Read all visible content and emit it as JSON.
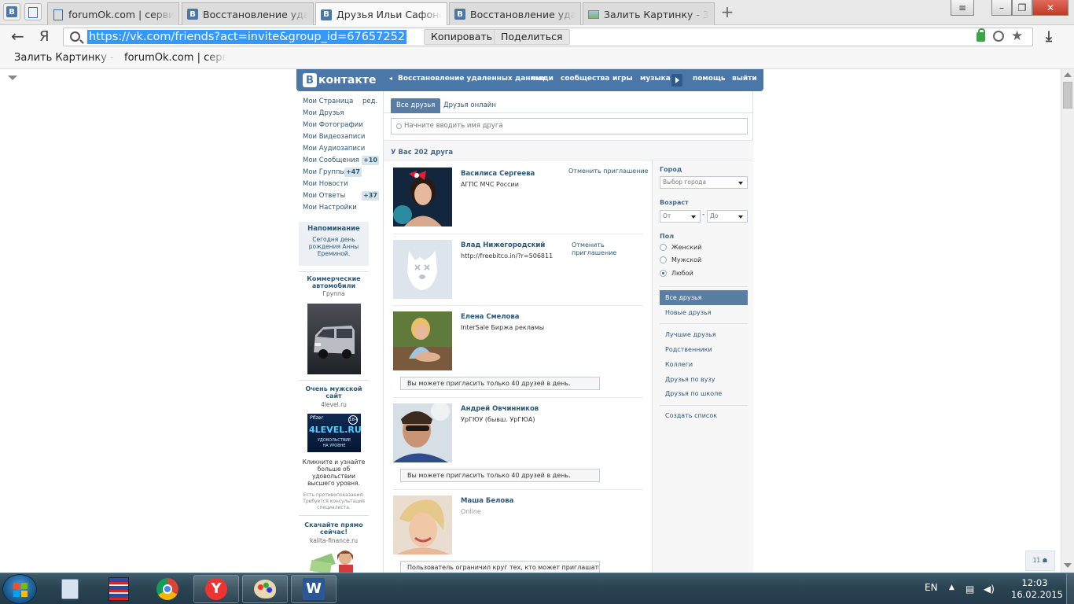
{
  "browser": {
    "tabs": [
      {
        "title": "forumOk.com | серви"
      },
      {
        "title": "Восстановление удал"
      },
      {
        "title": "Друзья Ильи Сафоно"
      },
      {
        "title": "Восстановление удал"
      },
      {
        "title": "Залить Картинку - За"
      }
    ],
    "new_tab_glyph": "+",
    "address": {
      "url": "https://vk.com/friends?act=invite&group_id=67657252",
      "copy_label": "Копировать",
      "share_label": "Поделиться"
    },
    "bookmarks": [
      "Залить Картинку - З",
      "forumOk.com | серв"
    ],
    "yandex_glyph": "Я"
  },
  "vk": {
    "logo_letter": "В",
    "logo_text": "контакте",
    "nav": {
      "back_link": "Восстановление удаленных данных",
      "links": [
        "люди",
        "сообщества",
        "игры",
        "музыка"
      ],
      "help": "помощь",
      "logout": "выйти"
    },
    "left_menu": {
      "edit": "ред.",
      "items": [
        {
          "label": "Мои Страница"
        },
        {
          "label": "Мои Друзья"
        },
        {
          "label": "Мои Фотографии"
        },
        {
          "label": "Мои Видеозаписи"
        },
        {
          "label": "Мои Аудиозаписи"
        },
        {
          "label": "Мои Сообщения",
          "count": "+10"
        },
        {
          "label": "Мои Группы",
          "count": "+47"
        },
        {
          "label": "Мои Новости"
        },
        {
          "label": "Мои Ответы",
          "count": "+37"
        },
        {
          "label": "Мои Настройки"
        }
      ]
    },
    "reminder": {
      "title": "Напоминание",
      "line1": "Сегодня день",
      "line2": "рождения Анны",
      "line3": "Ереминой."
    },
    "ads": [
      {
        "title1": "Коммерческие",
        "title2": "автомобили",
        "sub": "Группа"
      },
      {
        "title1": "Очень мужской",
        "title2": "сайт",
        "sub": "4level.ru",
        "banner_brand": "Pfizer",
        "banner_text": "4LEVEL.RU",
        "banner_tag1": "УДОВОЛЬСТВИЕ",
        "banner_tag2": "НА УРОВНЕ",
        "banner_age": "18+",
        "desc1": "Кликните и узнайте",
        "desc2": "больше об",
        "desc3": "удовольствии",
        "desc4": "высшего уровня.",
        "warn1": "Есть противопоказания.",
        "warn2": "Требуется консультация",
        "warn3": "специалиста."
      },
      {
        "title1": "Скачайте прямо",
        "title2": "сейчас!",
        "sub": "kalita-finance.ru"
      }
    ],
    "tabs": {
      "all": "Все друзья",
      "online": "Друзья онлайн"
    },
    "search_placeholder": "Начните вводить имя друга",
    "friends_count_text": "У Вас 202 друга",
    "friends": [
      {
        "name": "Василиса Сергеева",
        "sub": "АГПС МЧС России",
        "action": "Отменить приглашение"
      },
      {
        "name": "Влад Нижегородский",
        "sub": "http://freebitco.in/?r=506811",
        "action1": "Отменить",
        "action2": "приглашение"
      },
      {
        "name": "Елена Смелова",
        "sub": "InterSale Биржа рекламы",
        "notice": "Вы можете пригласить только 40 друзей в день."
      },
      {
        "name": "Андрей Овчинников",
        "sub": "УрГЮУ (бывш. УрГЮА)",
        "notice": "Вы можете пригласить только 40 друзей в день."
      },
      {
        "name": "Маша Белова",
        "sub": "Online",
        "notice": "Пользователь ограничил круг тех, кто может приглашать его"
      }
    ],
    "filters": {
      "city_label": "Город",
      "city_select": "Выбор города",
      "age_label": "Возраст",
      "age_from": "От",
      "age_dash": "-",
      "age_to": "До",
      "sex_label": "Пол",
      "sex_options": [
        "Женский",
        "Мужской",
        "Любой"
      ],
      "sex_selected": "Любой",
      "lists": {
        "all": "Все друзья",
        "new": "Новые друзья",
        "best": "Лучшие друзья",
        "relatives": "Родственники",
        "colleagues": "Коллеги",
        "uni": "Друзья по вузу",
        "school": "Друзья по школе",
        "create": "Создать список"
      }
    },
    "chat_count": "11"
  },
  "taskbar": {
    "lang": "EN",
    "time": "12:03",
    "date": "16.02.2015"
  },
  "colors": {
    "vk_blue": "#4a76a8",
    "vk_link": "#2b587a",
    "url_highlight": "#3399ff"
  }
}
